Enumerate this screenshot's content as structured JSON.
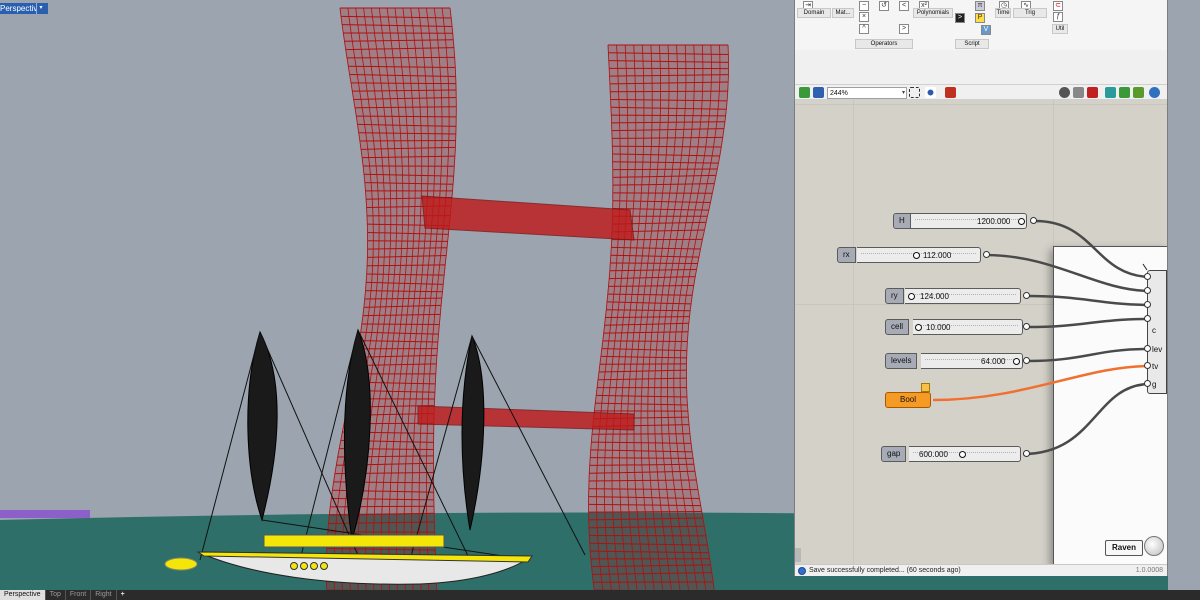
{
  "viewport": {
    "title": "Perspective*",
    "menu_glyph": "▾",
    "colors": {
      "sky": "#9ba4af",
      "ground": "#2f6f6a",
      "tower_wire": "#b01010",
      "bridge": "#c01818",
      "boat_hull": "#f5e60a",
      "sail": "#1a1a1a"
    }
  },
  "tabs": {
    "items": [
      {
        "label": "Perspective",
        "active": true
      },
      {
        "label": "Top",
        "active": false
      },
      {
        "label": "Front",
        "active": false
      },
      {
        "label": "Right",
        "active": false
      }
    ],
    "add_glyph": "+"
  },
  "grasshopper": {
    "ribbon": {
      "labels": {
        "domain": "Domain",
        "mat": "Mat...",
        "polynomials": "Polynomials",
        "operators": "Operators",
        "script": "Script",
        "time": "Time",
        "trig": "Trig",
        "util": "Util"
      }
    },
    "toolbar": {
      "zoom_value": "244%",
      "zoom_drop": "▾"
    },
    "sliders": [
      {
        "name": "H",
        "value": "1200.000"
      },
      {
        "name": "rx",
        "value": "112.000"
      },
      {
        "name": "ry",
        "value": "124.000"
      },
      {
        "name": "cell",
        "value": "10.000"
      },
      {
        "name": "levels",
        "value": "64.000"
      },
      {
        "name": "gap",
        "value": "600.000"
      }
    ],
    "toggle": {
      "label": "Bool"
    },
    "component_inputs": [
      "c",
      "lev",
      "tv",
      "g"
    ],
    "raven": {
      "label": "Raven"
    },
    "status": {
      "message": "Save successfully completed... (60 seconds ago)",
      "version": "1.0.0008"
    },
    "colors": {
      "canvas": "#d4d1c9",
      "slider_name": "#a6abb6",
      "toggle": "#f49a25",
      "wire": "#4a4a4a",
      "wire_active": "#f07030"
    }
  }
}
